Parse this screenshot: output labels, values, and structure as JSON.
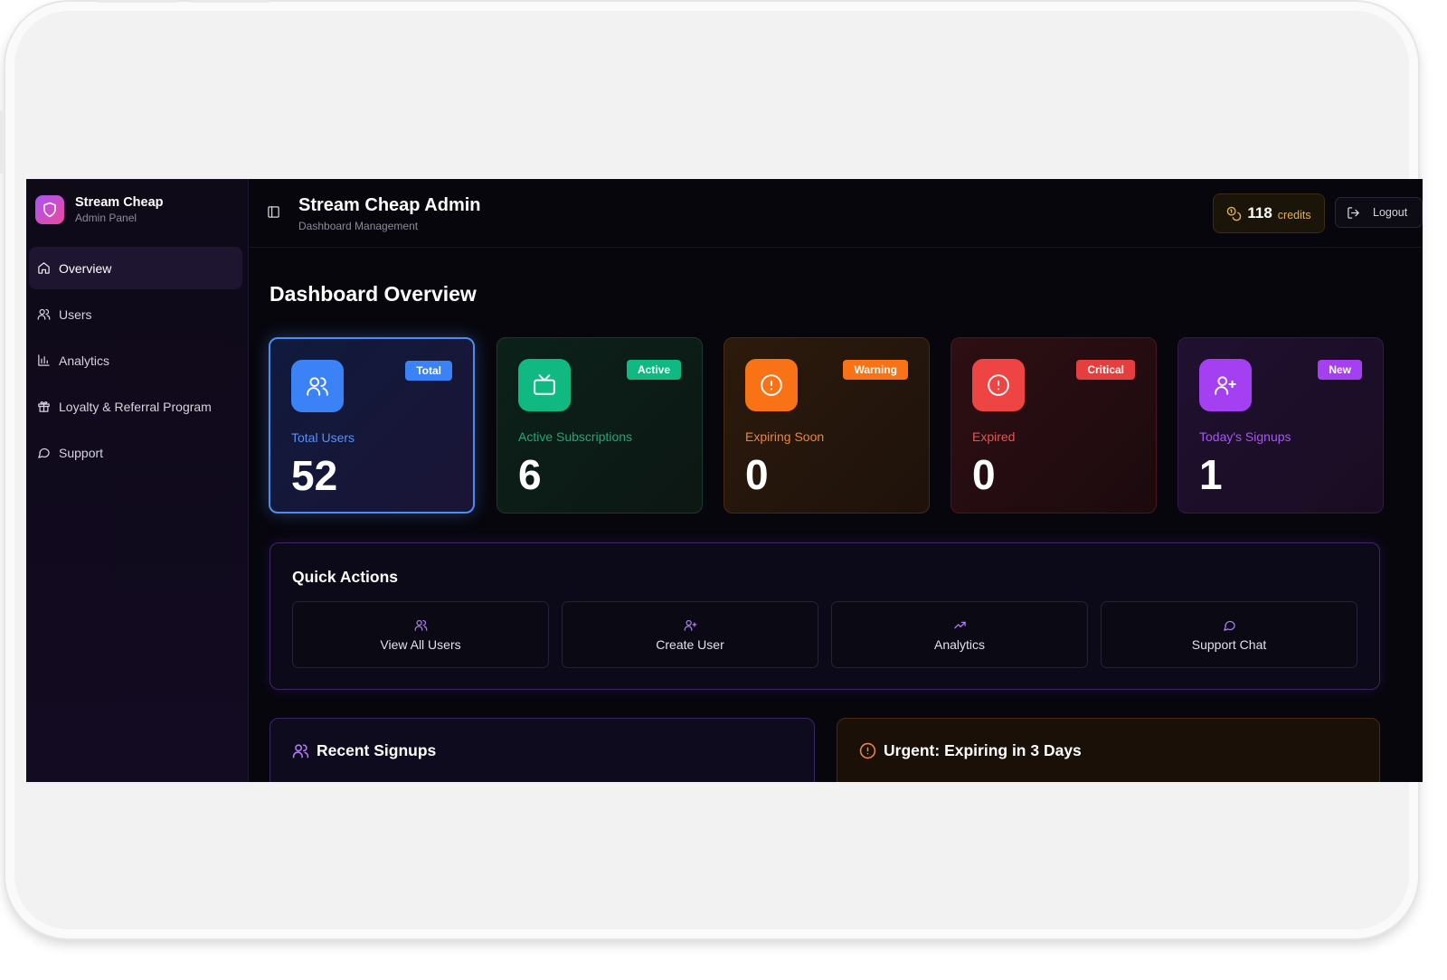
{
  "brand": {
    "title": "Stream Cheap",
    "subtitle": "Admin Panel"
  },
  "sidebar": {
    "items": [
      {
        "label": "Overview",
        "icon": "home-icon",
        "active": true
      },
      {
        "label": "Users",
        "icon": "users-icon"
      },
      {
        "label": "Analytics",
        "icon": "bar-chart-icon"
      },
      {
        "label": "Loyalty & Referral Program",
        "icon": "gift-icon"
      },
      {
        "label": "Support",
        "icon": "message-circle-icon"
      }
    ]
  },
  "header": {
    "title": "Stream Cheap Admin",
    "subtitle": "Dashboard Management",
    "credits_value": "118",
    "credits_label": "credits",
    "logout_label": "Logout"
  },
  "page": {
    "title": "Dashboard Overview"
  },
  "stats": [
    {
      "badge": "Total",
      "label": "Total Users",
      "value": "52",
      "icon": "users-icon",
      "color": "#3b82f6"
    },
    {
      "badge": "Active",
      "label": "Active Subscriptions",
      "value": "6",
      "icon": "tv-icon",
      "color": "#10b981"
    },
    {
      "badge": "Warning",
      "label": "Expiring Soon",
      "value": "0",
      "icon": "alert-circle-icon",
      "color": "#f97316"
    },
    {
      "badge": "Critical",
      "label": "Expired",
      "value": "0",
      "icon": "alert-circle-icon",
      "color": "#ef4444"
    },
    {
      "badge": "New",
      "label": "Today's Signups",
      "value": "1",
      "icon": "user-plus-icon",
      "color": "#a855f7"
    }
  ],
  "quick_actions": {
    "title": "Quick Actions",
    "items": [
      {
        "label": "View All Users",
        "icon": "users-icon"
      },
      {
        "label": "Create User",
        "icon": "user-plus-icon"
      },
      {
        "label": "Analytics",
        "icon": "trending-up-icon"
      },
      {
        "label": "Support Chat",
        "icon": "message-circle-icon"
      }
    ]
  },
  "panels": {
    "recent_signups": {
      "title": "Recent Signups",
      "icon": "users-icon"
    },
    "urgent": {
      "title": "Urgent: Expiring in 3 Days",
      "icon": "alert-circle-icon"
    }
  },
  "colors": {
    "accent_purple": "#a855f7",
    "accent_blue": "#3b82f6",
    "credits_gold": "#e7b343",
    "background": "#07060d"
  }
}
